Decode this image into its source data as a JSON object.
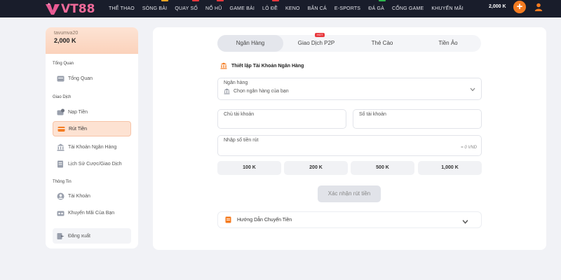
{
  "brand": {
    "logo_text": "VT88",
    "logo_color": "#f06a9a"
  },
  "nav": {
    "items": [
      {
        "label": "THỂ THAO",
        "tag": ""
      },
      {
        "label": "SÒNG BÀI",
        "tag": "#f5a623"
      },
      {
        "label": "QUAY SỐ",
        "tag": "#e8383d"
      },
      {
        "label": "NỔ HŨ",
        "tag": "#e8383d"
      },
      {
        "label": "GAME BÀI",
        "tag": ""
      },
      {
        "label": "LÔ ĐỀ",
        "tag": "#e8383d"
      },
      {
        "label": "KENO",
        "tag": ""
      },
      {
        "label": "BẮN CÁ",
        "tag": ""
      },
      {
        "label": "E-SPORTS",
        "tag": ""
      },
      {
        "label": "ĐÁ GÀ",
        "tag": "#2db84d"
      },
      {
        "label": "CỔNG GAME",
        "tag": ""
      },
      {
        "label": "KHUYẾN MÃI",
        "tag": ""
      }
    ],
    "balance": "2,000 K",
    "plus_icon": "plus-icon",
    "user_icon": "user-icon"
  },
  "sidebar": {
    "username": "tavumva20",
    "balance": "2,000 K",
    "sections": {
      "overview": "Tổng Quan",
      "transactions": "Giao Dịch",
      "info": "Thông Tin"
    },
    "items": {
      "overview": "Tổng Quan",
      "deposit": "Nạp Tiền",
      "withdraw": "Rút Tiền",
      "bank_account": "Tài Khoản Ngân Hàng",
      "history": "Lịch Sử Cược/Giao Dịch",
      "account": "Tài Khoản",
      "promotions": "Khuyến Mãi Của Bạn",
      "logout": "Đăng xuất"
    }
  },
  "main": {
    "tabs": [
      "Ngân Hàng",
      "Giao Dịch P2P",
      "Thẻ Cào",
      "Tiền Ảo"
    ],
    "active_tab": "Ngân Hàng",
    "hot_badge": "HOT",
    "section_title": "Thiết lập Tài Khoản Ngân Hàng",
    "bank_field": {
      "label": "Ngân hàng",
      "placeholder": "Chọn ngân hàng của bạn"
    },
    "holder_field": {
      "label": "Chủ tài khoản"
    },
    "account_no_field": {
      "label": "Số tài khoản"
    },
    "amount_field": {
      "label": "Nhập số tiền rút",
      "hint": "= 0 VND"
    },
    "quick_amounts": [
      "100 K",
      "200 K",
      "500 K",
      "1,000 K"
    ],
    "submit_label": "Xác nhận rút tiền",
    "guide_label": "Hướng Dẫn Chuyển Tiền"
  },
  "colors": {
    "accent": "#f47b20",
    "topbar": "#191d2b",
    "active_item": "#fde2d2"
  }
}
